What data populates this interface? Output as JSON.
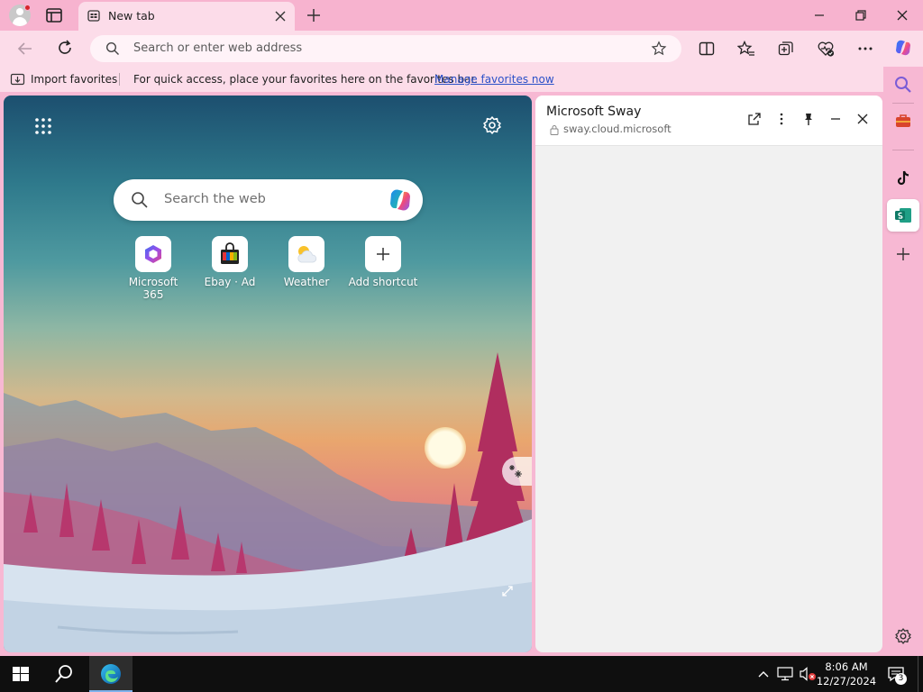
{
  "browser": {
    "tab": {
      "title": "New tab"
    },
    "address_bar": {
      "placeholder": "Search or enter web address"
    },
    "favorites_bar": {
      "import_label": "Import favorites",
      "hint": "For quick access, place your favorites here on the favorites bar.",
      "manage_link": "Manage favorites now"
    }
  },
  "new_tab_page": {
    "search": {
      "placeholder": "Search the web"
    },
    "shortcuts": [
      {
        "label": "Microsoft 365",
        "icon": "microsoft-365-icon"
      },
      {
        "label": "Ebay · Ad",
        "icon": "ebay-bag-icon"
      },
      {
        "label": "Weather",
        "icon": "weather-icon"
      },
      {
        "label": "Add shortcut",
        "icon": "plus-icon"
      }
    ]
  },
  "side_pane": {
    "title": "Microsoft Sway",
    "url": "sway.cloud.microsoft"
  },
  "sidebar": {
    "items": [
      "search-icon",
      "tools-icon",
      "tiktok-icon",
      "sway-icon",
      "add-icon",
      "settings-icon"
    ]
  },
  "taskbar": {
    "time": "8:06 AM",
    "date": "12/27/2024",
    "notification_count": "3"
  },
  "colors": {
    "chrome_pink": "#f7b3cf",
    "toolbar_pink": "#fcdce9",
    "link_blue": "#2a50c8",
    "taskbar": "#0f0f0f"
  }
}
